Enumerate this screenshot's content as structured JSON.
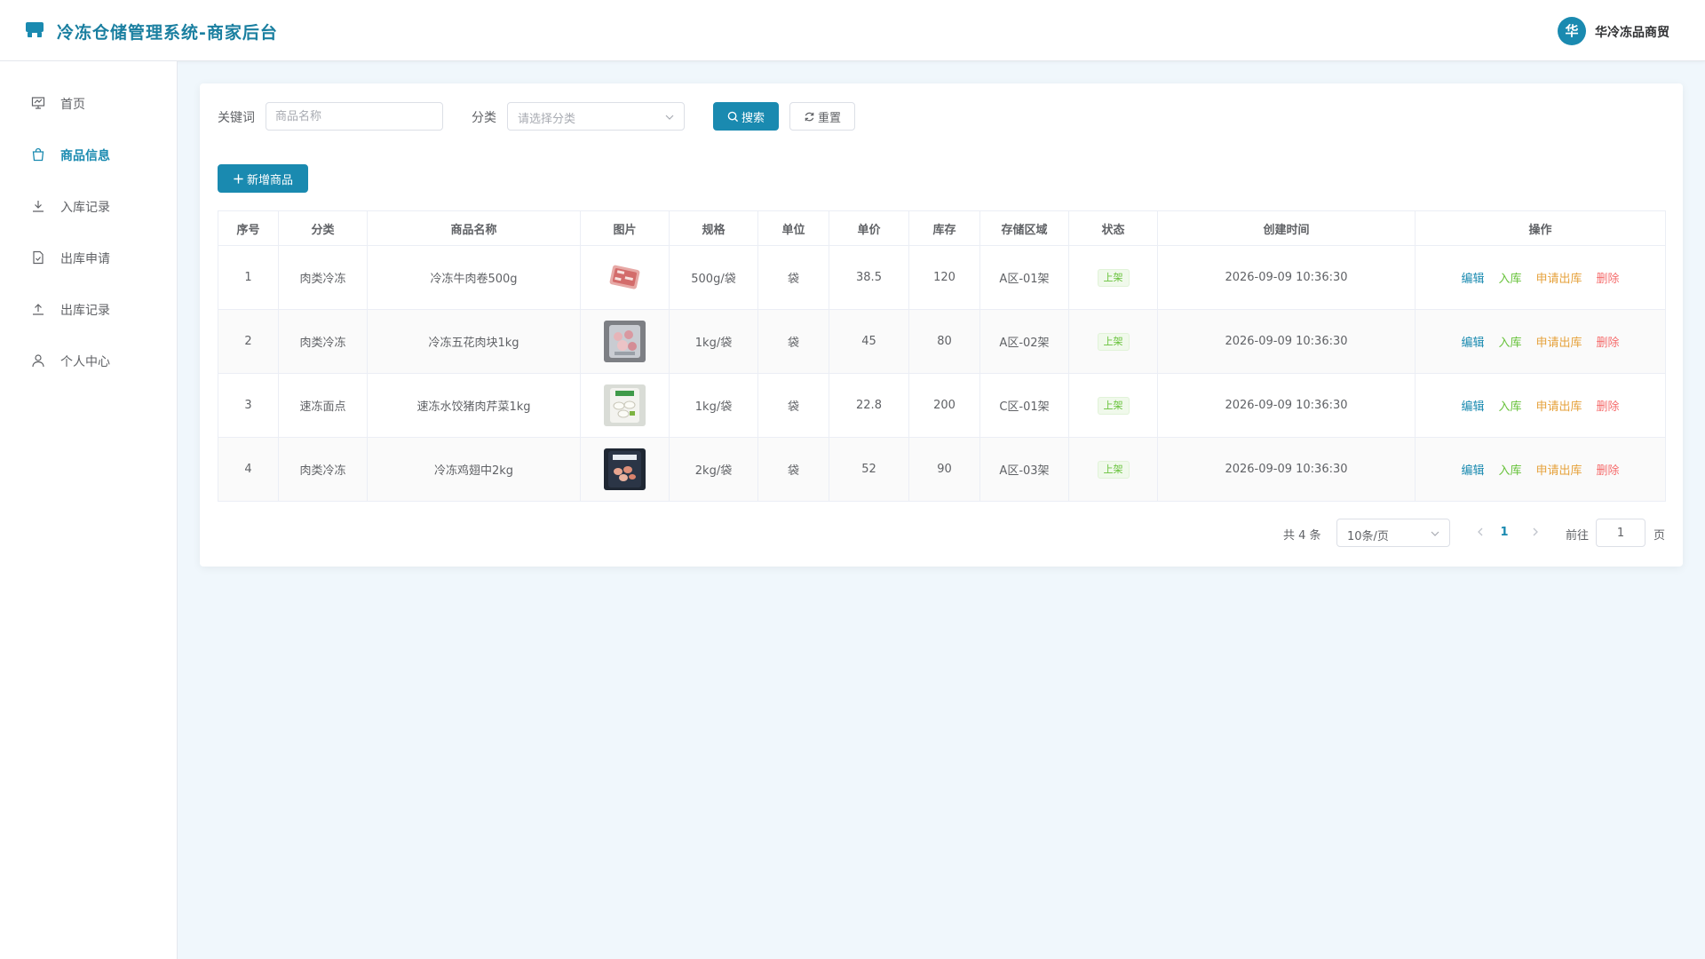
{
  "header": {
    "title": "冷冻仓储管理系统-商家后台",
    "avatar_char": "华",
    "merchant_name": "华冷冻品商贸",
    "brand_color": "#1a8ab0"
  },
  "sidebar": {
    "items": [
      {
        "label": "首页",
        "icon": "presentation-board-icon"
      },
      {
        "label": "商品信息",
        "icon": "shopping-bag-icon",
        "active": true
      },
      {
        "label": "入库记录",
        "icon": "download-icon"
      },
      {
        "label": "出库申请",
        "icon": "document-check-icon"
      },
      {
        "label": "出库记录",
        "icon": "upload-icon"
      },
      {
        "label": "个人中心",
        "icon": "user-icon"
      }
    ]
  },
  "search": {
    "keyword_label": "关键词",
    "keyword_placeholder": "商品名称",
    "keyword_value": "",
    "category_label": "分类",
    "category_placeholder": "请选择分类",
    "search_label": "搜索",
    "reset_label": "重置"
  },
  "toolbar": {
    "add_label": "新增商品"
  },
  "table": {
    "columns": [
      "序号",
      "分类",
      "商品名称",
      "图片",
      "规格",
      "单位",
      "单价",
      "库存",
      "存储区域",
      "状态",
      "创建时间",
      "操作"
    ],
    "rows": [
      {
        "index": "1",
        "category": "肉类冷冻",
        "name": "冷冻牛肉卷500g",
        "spec": "500g/袋",
        "unit": "袋",
        "price": "38.5",
        "stock": "120",
        "zone": "A区-01架",
        "status": "上架",
        "created": "2026-09-09 10:36:30"
      },
      {
        "index": "2",
        "category": "肉类冷冻",
        "name": "冷冻五花肉块1kg",
        "spec": "1kg/袋",
        "unit": "袋",
        "price": "45",
        "stock": "80",
        "zone": "A区-02架",
        "status": "上架",
        "created": "2026-09-09 10:36:30"
      },
      {
        "index": "3",
        "category": "速冻面点",
        "name": "速冻水饺猪肉芹菜1kg",
        "spec": "1kg/袋",
        "unit": "袋",
        "price": "22.8",
        "stock": "200",
        "zone": "C区-01架",
        "status": "上架",
        "created": "2026-09-09 10:36:30"
      },
      {
        "index": "4",
        "category": "肉类冷冻",
        "name": "冷冻鸡翅中2kg",
        "spec": "2kg/袋",
        "unit": "袋",
        "price": "52",
        "stock": "90",
        "zone": "A区-03架",
        "status": "上架",
        "created": "2026-09-09 10:36:30"
      }
    ],
    "actions": {
      "edit": "编辑",
      "stock_in": "入库",
      "request_out": "申请出库",
      "delete": "删除"
    }
  },
  "pagination": {
    "total_text": "共 4 条",
    "page_size": "10条/页",
    "current_page": "1",
    "goto_label": "前往",
    "goto_value": "1",
    "page_suffix": "页"
  }
}
